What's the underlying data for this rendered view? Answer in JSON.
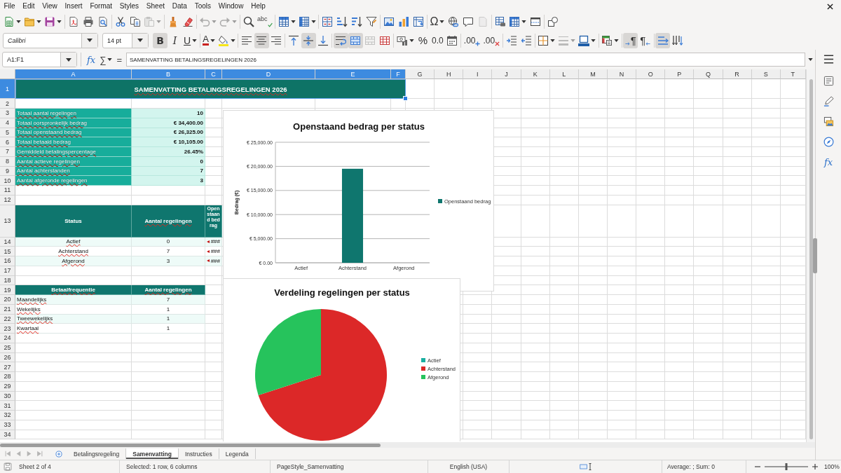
{
  "menu": [
    "File",
    "Edit",
    "View",
    "Insert",
    "Format",
    "Styles",
    "Sheet",
    "Data",
    "Tools",
    "Window",
    "Help"
  ],
  "standard_toolbar": {
    "groups": [
      [
        {
          "kind": "new",
          "dropdown": true,
          "disabled": false
        },
        {
          "kind": "open",
          "dropdown": true,
          "disabled": false
        },
        {
          "kind": "save",
          "dropdown": true,
          "disabled": false
        }
      ],
      [
        {
          "kind": "pdf",
          "dropdown": false,
          "disabled": false
        },
        {
          "kind": "print",
          "dropdown": false,
          "disabled": false
        },
        {
          "kind": "preview",
          "dropdown": false,
          "disabled": false
        }
      ],
      [
        {
          "kind": "cut",
          "dropdown": false,
          "disabled": false
        },
        {
          "kind": "copy",
          "dropdown": false,
          "disabled": false
        },
        {
          "kind": "paste",
          "dropdown": true,
          "disabled": true
        }
      ],
      [
        {
          "kind": "clone",
          "dropdown": false,
          "disabled": false
        },
        {
          "kind": "clear",
          "dropdown": false,
          "disabled": false
        }
      ],
      [
        {
          "kind": "undo",
          "dropdown": true,
          "disabled": true
        },
        {
          "kind": "redo",
          "dropdown": true,
          "disabled": true
        }
      ],
      [
        {
          "kind": "find",
          "dropdown": false,
          "disabled": false
        },
        {
          "kind": "spelling",
          "glyph": "abc",
          "dropdown": false,
          "disabled": false
        }
      ],
      [
        {
          "kind": "rows",
          "dropdown": true,
          "disabled": false
        },
        {
          "kind": "columns",
          "dropdown": true,
          "disabled": false
        }
      ],
      [
        {
          "kind": "sort",
          "dropdown": false,
          "disabled": false
        },
        {
          "kind": "sortasc",
          "dropdown": false,
          "disabled": false
        },
        {
          "kind": "sortdesc",
          "dropdown": false,
          "disabled": false
        },
        {
          "kind": "filter",
          "dropdown": false,
          "disabled": false
        }
      ],
      [
        {
          "kind": "image",
          "dropdown": false,
          "disabled": false
        },
        {
          "kind": "chart",
          "dropdown": false,
          "disabled": false
        },
        {
          "kind": "pivot",
          "dropdown": false,
          "disabled": false
        }
      ],
      [
        {
          "kind": "special",
          "glyph": "Ω",
          "dropdown": true,
          "disabled": false
        },
        {
          "kind": "hyperlink",
          "dropdown": false,
          "disabled": false
        },
        {
          "kind": "comment",
          "dropdown": false,
          "disabled": false
        },
        {
          "kind": "headers",
          "dropdown": false,
          "disabled": true
        }
      ],
      [
        {
          "kind": "printarea",
          "dropdown": false,
          "disabled": false
        },
        {
          "kind": "freeze",
          "dropdown": true,
          "disabled": false
        },
        {
          "kind": "split",
          "dropdown": false,
          "disabled": false
        }
      ],
      [
        {
          "kind": "shapes",
          "dropdown": false,
          "disabled": false
        }
      ]
    ]
  },
  "formatting_toolbar": {
    "font_name": "Calibri",
    "font_size": "14 pt",
    "groups": [
      [
        {
          "kind": "bold",
          "glyph": "B",
          "dropdown": false,
          "disabled": false,
          "on": true
        },
        {
          "kind": "italic",
          "glyph": "I",
          "dropdown": false,
          "disabled": false,
          "on": false
        },
        {
          "kind": "underline",
          "glyph": "U",
          "dropdown": true,
          "disabled": false,
          "on": false
        }
      ],
      [
        {
          "kind": "fontcolor",
          "glyph": "A",
          "dropdown": true,
          "disabled": false,
          "on": false
        },
        {
          "kind": "highlight",
          "dropdown": true,
          "disabled": false,
          "on": false
        }
      ],
      [
        {
          "kind": "alignleft",
          "dropdown": false,
          "disabled": false,
          "on": false
        },
        {
          "kind": "aligncenter",
          "dropdown": false,
          "disabled": false,
          "on": true
        },
        {
          "kind": "alignright",
          "dropdown": false,
          "disabled": false,
          "on": false
        }
      ],
      [
        {
          "kind": "aligntop",
          "dropdown": false,
          "disabled": false,
          "on": false
        },
        {
          "kind": "alignmiddle",
          "dropdown": false,
          "disabled": false,
          "on": true
        },
        {
          "kind": "alignbottom",
          "dropdown": false,
          "disabled": false,
          "on": false
        }
      ],
      [
        {
          "kind": "wrap",
          "dropdown": false,
          "disabled": false,
          "on": true
        },
        {
          "kind": "mergecenter",
          "dropdown": false,
          "disabled": false,
          "on": true
        },
        {
          "kind": "merge",
          "dropdown": false,
          "disabled": true,
          "on": false
        },
        {
          "kind": "unmerge",
          "dropdown": false,
          "disabled": false,
          "on": false
        }
      ],
      [
        {
          "kind": "currency",
          "dropdown": true,
          "disabled": false,
          "on": false
        },
        {
          "kind": "percent",
          "glyph": "%",
          "dropdown": false,
          "disabled": false,
          "on": false
        },
        {
          "kind": "number",
          "glyph": "0.0",
          "dropdown": false,
          "disabled": false,
          "on": false
        },
        {
          "kind": "date",
          "dropdown": false,
          "disabled": false,
          "on": false
        }
      ],
      [
        {
          "kind": "adddecimal",
          "glyph": ".00",
          "dropdown": false,
          "disabled": false,
          "on": false
        },
        {
          "kind": "deldecimal",
          "glyph": ".00",
          "dropdown": false,
          "disabled": false,
          "on": false
        }
      ],
      [
        {
          "kind": "indent",
          "dropdown": false,
          "disabled": false,
          "on": false
        },
        {
          "kind": "outdent",
          "dropdown": false,
          "disabled": false,
          "on": false
        }
      ],
      [
        {
          "kind": "borders",
          "dropdown": true,
          "disabled": false,
          "on": false
        },
        {
          "kind": "borderstyle",
          "dropdown": true,
          "disabled": true,
          "on": false
        },
        {
          "kind": "bordercolor",
          "dropdown": true,
          "disabled": false,
          "on": false
        }
      ],
      [
        {
          "kind": "conditional",
          "dropdown": true,
          "disabled": false,
          "on": false
        }
      ],
      [
        {
          "kind": "ltr",
          "glyph": "¶",
          "dropdown": false,
          "disabled": false,
          "on": true
        },
        {
          "kind": "rtl",
          "glyph": "¶",
          "dropdown": false,
          "disabled": false,
          "on": false
        }
      ],
      [
        {
          "kind": "textltr",
          "dropdown": false,
          "disabled": false,
          "on": true
        },
        {
          "kind": "texttb",
          "dropdown": false,
          "disabled": false,
          "on": false
        }
      ]
    ]
  },
  "formula_bar": {
    "name_box": "A1:F1",
    "function_wizard": "fx",
    "sum": "∑",
    "equals": "=",
    "content": "SAMENVATTING BETALINGSREGELINGEN 2026"
  },
  "sheet": {
    "column_headers": [
      {
        "label": "A",
        "selected": true
      },
      {
        "label": "B",
        "selected": true
      },
      {
        "label": "C",
        "selected": true
      },
      {
        "label": "D",
        "selected": true
      },
      {
        "label": "E",
        "selected": true
      },
      {
        "label": "F",
        "selected": true
      },
      {
        "label": "G",
        "selected": false
      },
      {
        "label": "H",
        "selected": false
      },
      {
        "label": "I",
        "selected": false
      },
      {
        "label": "J",
        "selected": false
      },
      {
        "label": "K",
        "selected": false
      },
      {
        "label": "L",
        "selected": false
      },
      {
        "label": "M",
        "selected": false
      },
      {
        "label": "N",
        "selected": false
      },
      {
        "label": "O",
        "selected": false
      },
      {
        "label": "P",
        "selected": false
      },
      {
        "label": "Q",
        "selected": false
      },
      {
        "label": "R",
        "selected": false
      },
      {
        "label": "S",
        "selected": false
      },
      {
        "label": "T",
        "selected": false
      }
    ],
    "row_headers": [
      {
        "label": "1",
        "selected": true
      },
      {
        "label": "2",
        "selected": false
      },
      {
        "label": "3",
        "selected": false
      },
      {
        "label": "4",
        "selected": false
      },
      {
        "label": "5",
        "selected": false
      },
      {
        "label": "6",
        "selected": false
      },
      {
        "label": "7",
        "selected": false
      },
      {
        "label": "8",
        "selected": false
      },
      {
        "label": "9",
        "selected": false
      },
      {
        "label": "10",
        "selected": false
      },
      {
        "label": "11",
        "selected": false
      },
      {
        "label": "12",
        "selected": false
      },
      {
        "label": "13",
        "selected": false
      },
      {
        "label": "14",
        "selected": false
      },
      {
        "label": "15",
        "selected": false
      },
      {
        "label": "16",
        "selected": false
      },
      {
        "label": "17",
        "selected": false
      },
      {
        "label": "18",
        "selected": false
      },
      {
        "label": "19",
        "selected": false
      },
      {
        "label": "20",
        "selected": false
      },
      {
        "label": "21",
        "selected": false
      },
      {
        "label": "22",
        "selected": false
      },
      {
        "label": "23",
        "selected": false
      },
      {
        "label": "24",
        "selected": false
      },
      {
        "label": "25",
        "selected": false
      },
      {
        "label": "26",
        "selected": false
      },
      {
        "label": "27",
        "selected": false
      },
      {
        "label": "28",
        "selected": false
      },
      {
        "label": "29",
        "selected": false
      },
      {
        "label": "30",
        "selected": false
      },
      {
        "label": "31",
        "selected": false
      },
      {
        "label": "32",
        "selected": false
      },
      {
        "label": "33",
        "selected": false
      },
      {
        "label": "34",
        "selected": false
      }
    ],
    "title_cell": {
      "text": "SAMENVATTING BETALINGSREGELINGEN 2026",
      "selected": true,
      "misspelled": true
    },
    "summary": [
      {
        "label": "Totaal aantal regelingen",
        "value": "10",
        "misspelled": true
      },
      {
        "label": "Totaal oorspronkelijk bedrag",
        "value": "€ 34,400.00",
        "misspelled": true
      },
      {
        "label": "Totaal openstaand bedrag",
        "value": "€ 26,325.00",
        "misspelled": true
      },
      {
        "label": "Totaal betaald bedrag",
        "value": "€ 10,105.00",
        "misspelled": true
      },
      {
        "label": "Gemiddeld betalingspercentage",
        "value": "26.45%",
        "misspelled": true
      },
      {
        "label": "Aantal actieve regelingen",
        "value": "0",
        "misspelled": true
      },
      {
        "label": "Aantal achterstanden",
        "value": "7",
        "misspelled": true
      },
      {
        "label": "Aantal afgeronde regelingen",
        "value": "3",
        "misspelled": true
      }
    ],
    "status_table": {
      "headers": [
        {
          "text": "Status",
          "misspelled": false
        },
        {
          "text": "Aantal regelingen",
          "misspelled": true
        },
        {
          "text": "Openstaand bedrag",
          "misspelled": false
        }
      ],
      "rows": [
        {
          "status": "Actief",
          "count": "0",
          "amount": "###",
          "misspelled": true
        },
        {
          "status": "Achterstand",
          "count": "7",
          "amount": "###",
          "misspelled": true
        },
        {
          "status": "Afgerond",
          "count": "3",
          "amount": "###",
          "misspelled": true
        }
      ]
    },
    "frequency_table": {
      "headers": [
        {
          "text": "Betaalfrequentie",
          "misspelled": true
        },
        {
          "text": "Aantal regelingen",
          "misspelled": true
        }
      ],
      "rows": [
        {
          "label": "Maandelijks",
          "count": "7",
          "misspelled": true
        },
        {
          "label": "Wekelijks",
          "count": "1",
          "misspelled": true
        },
        {
          "label": "Tweewekelijks",
          "count": "1",
          "misspelled": true
        },
        {
          "label": "Kwartaal",
          "count": "1",
          "misspelled": true
        }
      ]
    },
    "charts": [
      {
        "chart_data": {
          "type": "bar",
          "title": "Openstaand bedrag per status",
          "ylabel": "Bedrag (€)",
          "categories": [
            "Actief",
            "Achterstand",
            "Afgerond"
          ],
          "series": [
            {
              "name": "Openstaand bedrag",
              "color": "#0f766e",
              "values": [
                0,
                19500,
                0
              ]
            }
          ],
          "ylim": [
            0,
            25000
          ],
          "yticks": [
            {
              "value": 0,
              "label": "€ 0.00"
            },
            {
              "value": 5000,
              "label": "€ 5,000.00"
            },
            {
              "value": 10000,
              "label": "€ 10,000.00"
            },
            {
              "value": 15000,
              "label": "€ 15,000.00"
            },
            {
              "value": 20000,
              "label": "€ 20,000.00"
            },
            {
              "value": 25000,
              "label": "€ 25,000.00"
            }
          ],
          "grid": true,
          "legend": "right"
        }
      },
      {
        "chart_data": {
          "type": "pie",
          "title": "Verdeling regelingen per status",
          "categories": [
            "Actief",
            "Achterstand",
            "Afgerond"
          ],
          "values": [
            0,
            70,
            30
          ],
          "colors": [
            "#1aafa1",
            "#dc2828",
            "#26c35c"
          ],
          "legend": "right"
        }
      }
    ]
  },
  "sheet_nav": [
    {
      "kind": "first",
      "disabled": true
    },
    {
      "kind": "previous",
      "disabled": true
    },
    {
      "kind": "next",
      "disabled": true
    },
    {
      "kind": "last",
      "disabled": true
    }
  ],
  "sheet_tabs": [
    {
      "label": "Betalingsregeling",
      "selected": false
    },
    {
      "label": "Samenvatting",
      "selected": true
    },
    {
      "label": "Instructies",
      "selected": false
    },
    {
      "label": "Legenda",
      "selected": false
    }
  ],
  "sidebar": {
    "functions_label": "fx"
  },
  "status_bar": {
    "sheet": "Sheet 2 of 4",
    "selection": "Selected: 1 row, 6 columns",
    "page_style": "PageStyle_Samenvatting",
    "language": "English (USA)",
    "summary": "Average: ; Sum: 0",
    "zoom": {
      "level": 0.5,
      "reading": "100%"
    }
  }
}
